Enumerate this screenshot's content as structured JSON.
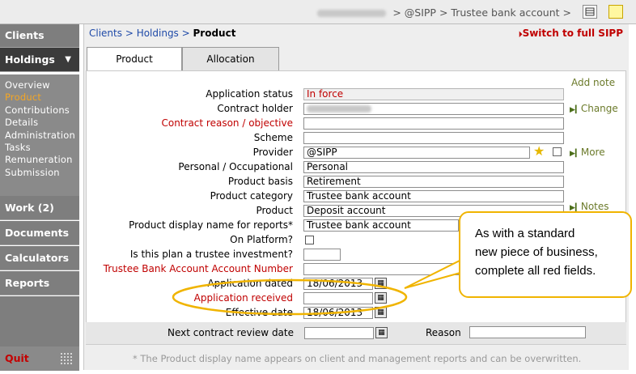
{
  "topbar": {
    "crumb": "> @SIPP > Trustee bank account >",
    "icons": [
      "calculator-icon",
      "sticky-note-icon"
    ]
  },
  "sidebar": {
    "clients": "Clients",
    "holdings": "Holdings",
    "holdings_arrow": "▼",
    "subitems": [
      "Overview",
      "Product",
      "Contributions",
      "Details",
      "Administration",
      "Tasks",
      "Remuneration",
      "Submission"
    ],
    "active_sub": "Product",
    "work": "Work (2)",
    "documents": "Documents",
    "calculators": "Calculators",
    "reports": "Reports",
    "quit": "Quit"
  },
  "breadcrumb": {
    "clients": "Clients",
    "sep": " > ",
    "holdings": "Holdings",
    "product": "Product"
  },
  "switch_link": "Switch to full SIPP",
  "tabs": {
    "product": "Product",
    "allocation": "Allocation"
  },
  "add_note": "Add note",
  "fields": {
    "application_status": {
      "label": "Application status",
      "value": "In force"
    },
    "contract_holder": {
      "label": "Contract holder",
      "value": ""
    },
    "contract_reason": {
      "label": "Contract reason / objective",
      "value": ""
    },
    "scheme": {
      "label": "Scheme",
      "value": ""
    },
    "provider": {
      "label": "Provider",
      "value": "@SIPP"
    },
    "personal_occ": {
      "label": "Personal / Occupational",
      "value": "Personal"
    },
    "product_basis": {
      "label": "Product basis",
      "value": "Retirement"
    },
    "product_category": {
      "label": "Product category",
      "value": "Trustee bank account"
    },
    "product": {
      "label": "Product",
      "value": "Deposit account"
    },
    "display_name": {
      "label": "Product display name for reports*",
      "value": "Trustee bank account"
    },
    "on_platform": {
      "label": "On Platform?"
    },
    "trustee_investment": {
      "label": "Is this plan a trustee investment?",
      "value": ""
    },
    "trustee_bank_acc": {
      "label": "Trustee Bank Account Account Number",
      "value": ""
    },
    "application_dated": {
      "label": "Application dated",
      "value": "18/06/2013"
    },
    "application_received": {
      "label": "Application received",
      "value": ""
    },
    "effective_date": {
      "label": "Effective date",
      "value": "18/06/2013"
    }
  },
  "links": {
    "change": "Change",
    "more": "More",
    "notes": "Notes"
  },
  "review": {
    "label": "Next contract review date",
    "value": "",
    "reason_label": "Reason",
    "reason_value": ""
  },
  "footnote": "* The Product display name appears on client and management reports and can be overwritten.",
  "callout": {
    "line1": "As with a standard",
    "line2": "new piece of business,",
    "line3": "complete all red fields."
  },
  "colors": {
    "required": "#c00000",
    "nav_dark": "#3b3b3b",
    "nav": "#7e7e7e",
    "highlight": "#f0b400",
    "active_sub": "#f5a623"
  }
}
